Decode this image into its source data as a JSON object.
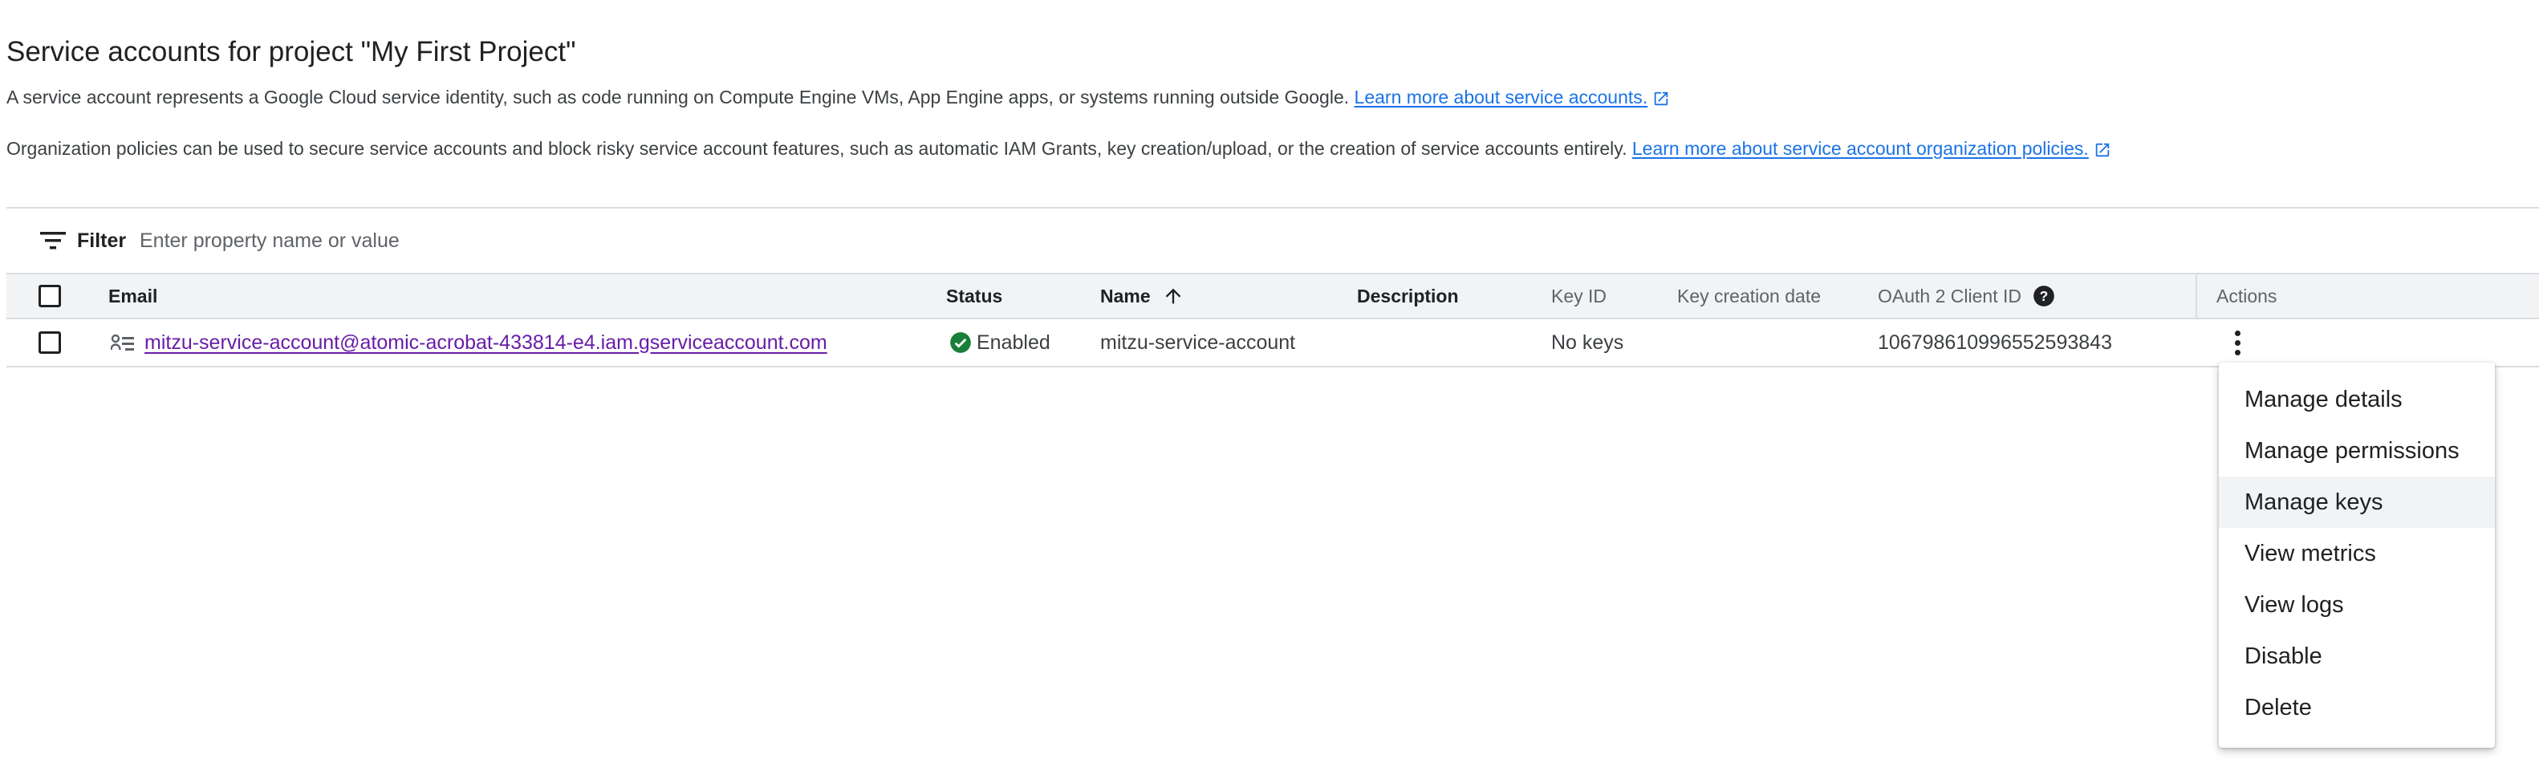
{
  "page": {
    "title": "Service accounts for project \"My First Project\"",
    "description_1": "A service account represents a Google Cloud service identity, such as code running on Compute Engine VMs, App Engine apps, or systems running outside Google.",
    "learn_more_1": "Learn more about service accounts.",
    "description_2": "Organization policies can be used to secure service accounts and block risky service account features, such as automatic IAM Grants, key creation/upload, or the creation of service accounts entirely.",
    "learn_more_2": "Learn more about service account organization policies."
  },
  "filter": {
    "label": "Filter",
    "placeholder": "Enter property name or value",
    "icon": "filter-icon"
  },
  "table": {
    "columns": {
      "email": "Email",
      "status": "Status",
      "name": "Name",
      "description": "Description",
      "key_id": "Key ID",
      "key_creation_date": "Key creation date",
      "oauth_client_id": "OAuth 2 Client ID",
      "actions": "Actions"
    },
    "sort": {
      "column": "name",
      "direction": "ascending"
    },
    "rows": [
      {
        "email": "mitzu-service-account@atomic-acrobat-433814-e4.iam.gserviceaccount.com",
        "status": "Enabled",
        "name": "mitzu-service-account",
        "description": "",
        "key_id": "No keys",
        "key_creation_date": "",
        "oauth_client_id": "106798610996552593843"
      }
    ]
  },
  "actions_menu": {
    "items": [
      "Manage details",
      "Manage permissions",
      "Manage keys",
      "View metrics",
      "View logs",
      "Disable",
      "Delete"
    ],
    "hovered_item": "Manage keys"
  },
  "colors": {
    "link": "#1a73e8",
    "visited_link": "#681da8",
    "status_enabled": "#188038",
    "header_bg": "#f1f3f4",
    "divider": "#dadce0"
  }
}
